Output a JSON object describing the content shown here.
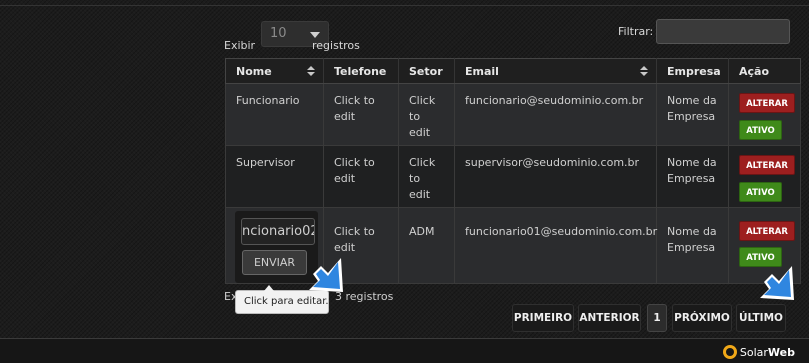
{
  "controls": {
    "show_label": "Exibir",
    "page_size": "10",
    "records_label": "registros",
    "filter_label": "Filtrar:",
    "filter_value": ""
  },
  "table": {
    "headers": [
      "Nome",
      "Telefone",
      "Setor",
      "Email",
      "Empresa",
      "Ação"
    ],
    "rows": [
      {
        "nome": "Funcionario",
        "telefone": "Click to edit",
        "setor": "Click to edit",
        "email": "funcionario@seudominio.com.br",
        "empresa": "Nome da Empresa",
        "alterar": "ALTERAR",
        "status": "ATIVO"
      },
      {
        "nome": "Supervisor",
        "telefone": "Click to edit",
        "setor": "Click to edit",
        "email": "supervisor@seudominio.com.br",
        "empresa": "Nome da Empresa",
        "alterar": "ALTERAR",
        "status": "ATIVO"
      },
      {
        "nome": "ncionario02",
        "telefone": "Click to edit",
        "setor": "ADM",
        "email": "funcionario01@seudominio.com.br",
        "empresa": "Nome da Empresa",
        "alterar": "ALTERAR",
        "status": "ATIVO"
      }
    ]
  },
  "inline_edit": {
    "value": "ncionario02",
    "submit_label": "ENVIAR",
    "tooltip": "Click para editar."
  },
  "info": {
    "prefix": "Ex",
    "suffix": "3 registros"
  },
  "pagination": {
    "first": "PRIMEIRO",
    "previous": "ANTERIOR",
    "current": "1",
    "next": "PRÓXIMO",
    "last": "ÚLTIMO"
  },
  "footer": {
    "brand_a": "Solar",
    "brand_b": "Web"
  },
  "colors": {
    "alterar": "#9d1f1f",
    "ativo": "#3f8a1a",
    "cursor": "#2f86e0",
    "logo": "#f0a818"
  },
  "icons": [
    "sort-icon",
    "dropdown-caret-icon",
    "pointer-cursor-icon",
    "sun-logo-icon"
  ]
}
